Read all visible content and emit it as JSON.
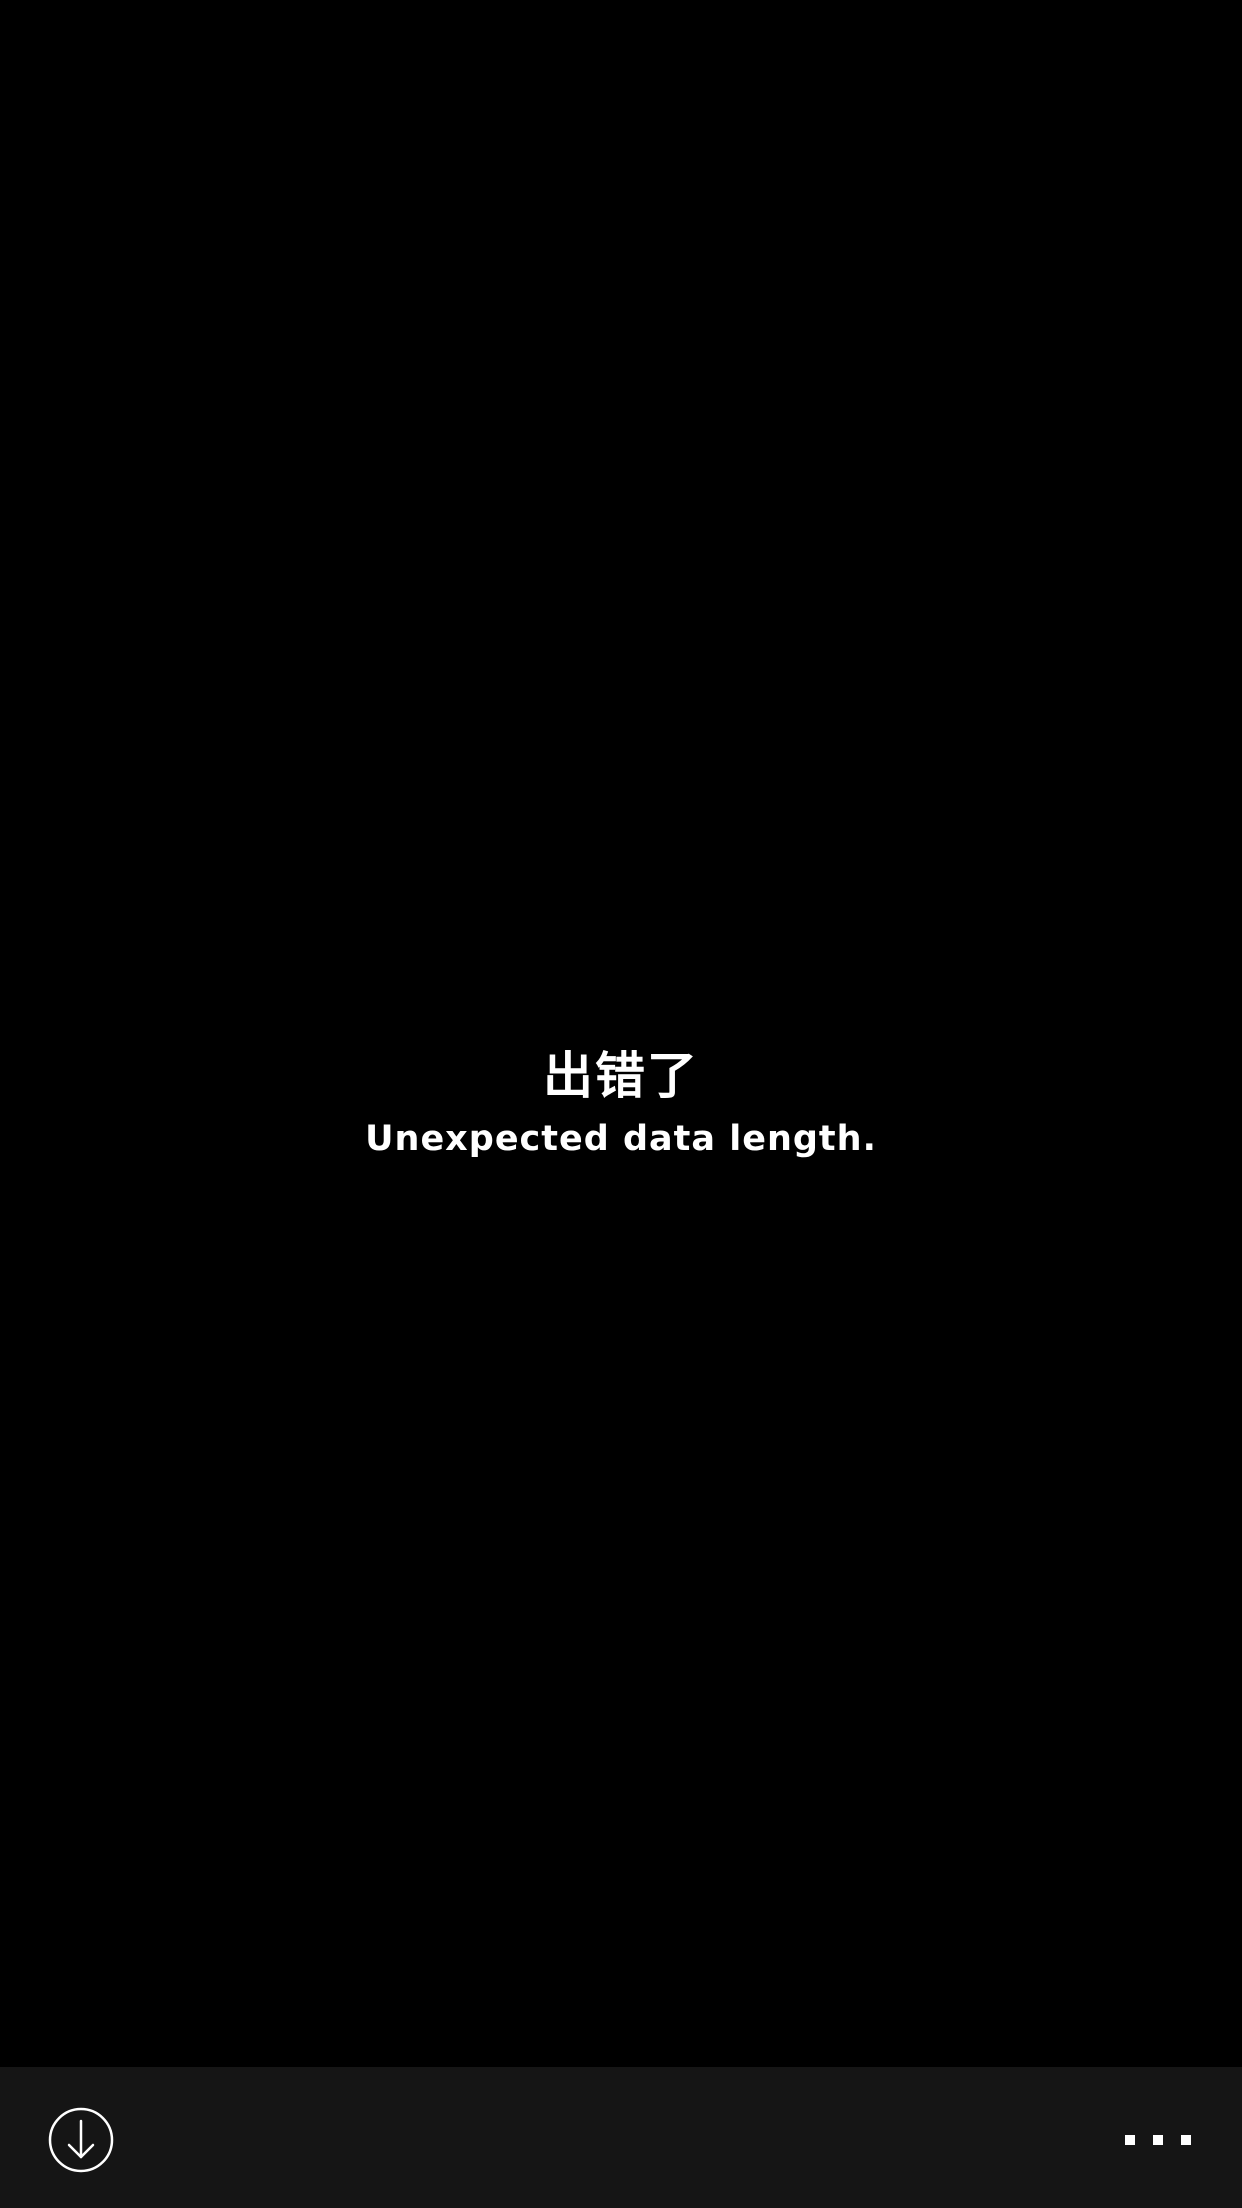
{
  "error": {
    "title": "出错了",
    "message": "Unexpected data length."
  },
  "toolbar": {
    "download_icon": "download-circle-icon",
    "more_icon": "more-dots-icon"
  },
  "colors": {
    "background": "#000000",
    "toolbar_background": "#151515",
    "text": "#ffffff"
  }
}
